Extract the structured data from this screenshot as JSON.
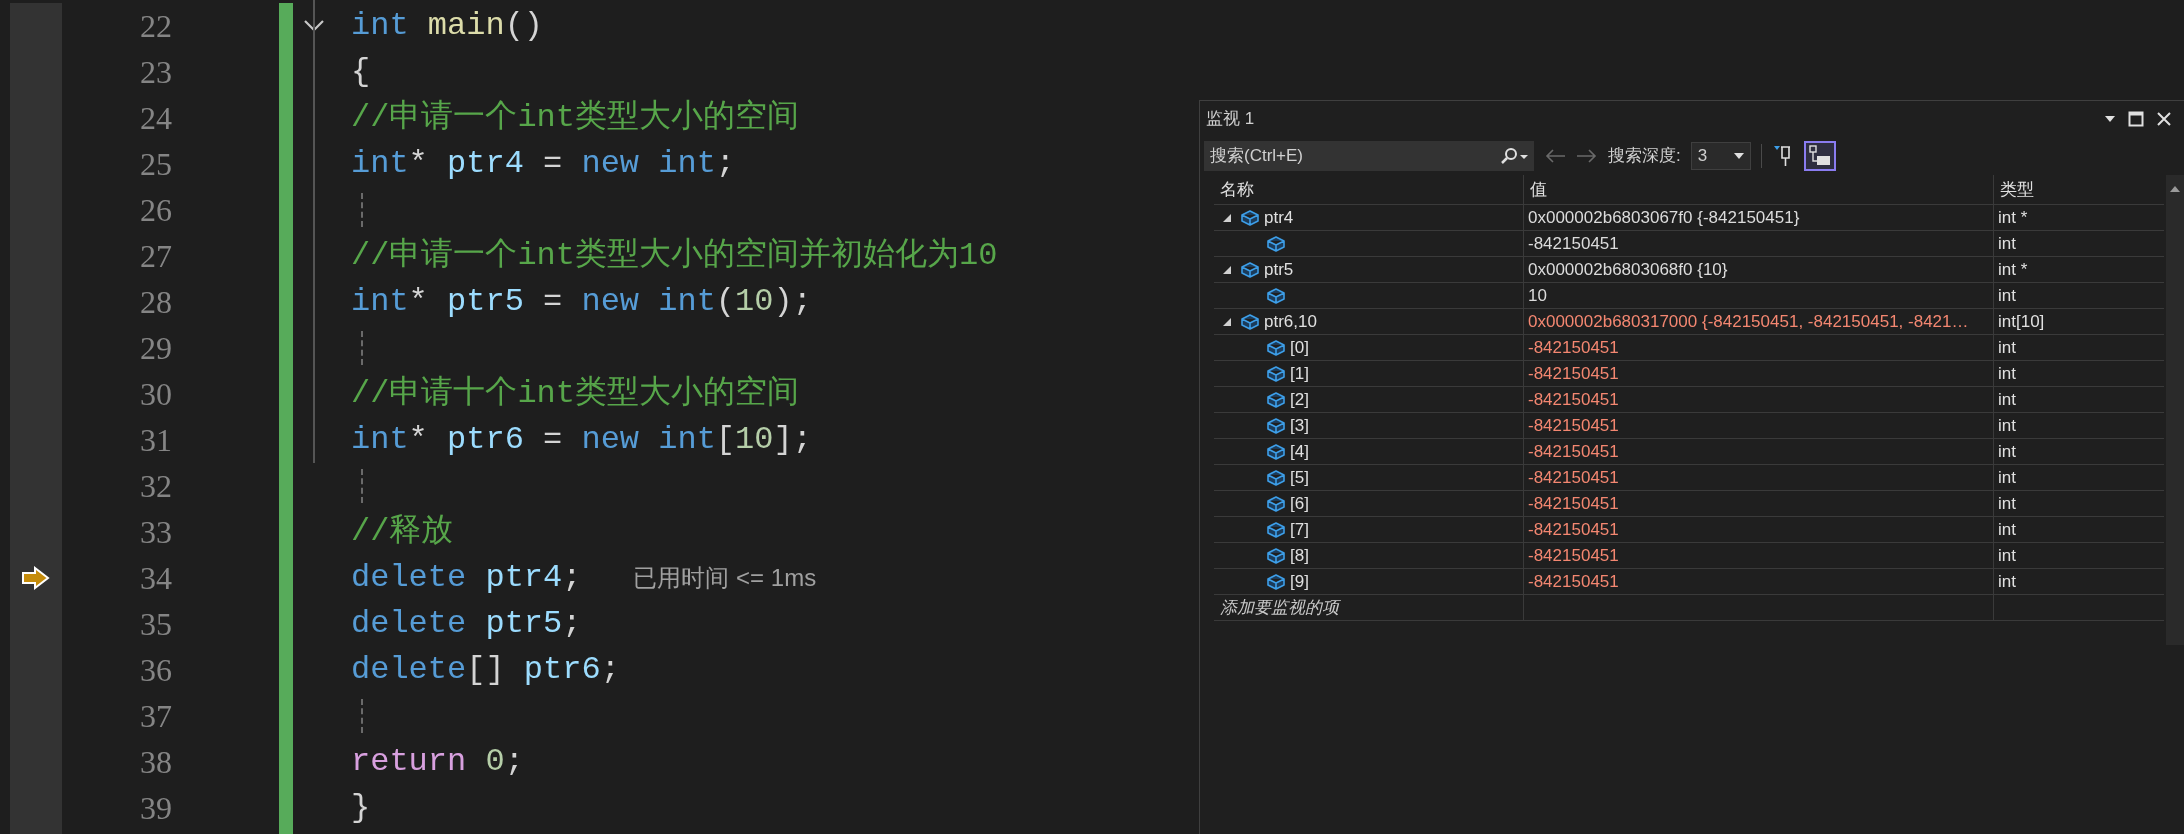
{
  "editor": {
    "lines": [
      {
        "number": "22",
        "folded": false,
        "tokens": [
          {
            "kind": "keyword",
            "text": "int"
          },
          {
            "kind": "function",
            "text": " main"
          },
          {
            "kind": "plain",
            "text": "()"
          }
        ]
      },
      {
        "number": "23",
        "tokens": [
          {
            "kind": "plain",
            "text": "{"
          }
        ]
      },
      {
        "number": "24",
        "tokens": [
          {
            "kind": "comment",
            "text": "//申请一个int类型大小的空间"
          }
        ]
      },
      {
        "number": "25",
        "tokens": [
          {
            "kind": "keyword",
            "text": "int"
          },
          {
            "kind": "plain",
            "text": "* "
          },
          {
            "kind": "variable",
            "text": "ptr4"
          },
          {
            "kind": "plain",
            "text": " = "
          },
          {
            "kind": "keyword",
            "text": "new"
          },
          {
            "kind": "keyword",
            "text": " int"
          },
          {
            "kind": "plain",
            "text": ";"
          }
        ]
      },
      {
        "number": "26"
      },
      {
        "number": "27",
        "tokens": [
          {
            "kind": "comment",
            "text": "//申请一个int类型大小的空间并初始化为10"
          }
        ]
      },
      {
        "number": "28",
        "tokens": [
          {
            "kind": "keyword",
            "text": "int"
          },
          {
            "kind": "plain",
            "text": "* "
          },
          {
            "kind": "variable",
            "text": "ptr5"
          },
          {
            "kind": "plain",
            "text": " = "
          },
          {
            "kind": "keyword",
            "text": "new"
          },
          {
            "kind": "keyword",
            "text": " int"
          },
          {
            "kind": "plain",
            "text": "("
          },
          {
            "kind": "number",
            "text": "10"
          },
          {
            "kind": "plain",
            "text": ");"
          }
        ]
      },
      {
        "number": "29"
      },
      {
        "number": "30",
        "tokens": [
          {
            "kind": "comment",
            "text": "//申请十个int类型大小的空间"
          }
        ]
      },
      {
        "number": "31",
        "tokens": [
          {
            "kind": "keyword",
            "text": "int"
          },
          {
            "kind": "plain",
            "text": "* "
          },
          {
            "kind": "variable",
            "text": "ptr6"
          },
          {
            "kind": "plain",
            "text": " = "
          },
          {
            "kind": "keyword",
            "text": "new"
          },
          {
            "kind": "keyword",
            "text": " int"
          },
          {
            "kind": "plain",
            "text": "["
          },
          {
            "kind": "number",
            "text": "10"
          },
          {
            "kind": "plain",
            "text": "];"
          }
        ]
      },
      {
        "number": "32"
      },
      {
        "number": "33",
        "tokens": [
          {
            "kind": "comment",
            "text": "//释放"
          }
        ]
      },
      {
        "number": "34",
        "current": true,
        "hint": "已用时间 <= 1ms",
        "tokens": [
          {
            "kind": "keyword",
            "text": "delete"
          },
          {
            "kind": "variable",
            "text": " ptr4"
          },
          {
            "kind": "plain",
            "text": ";"
          }
        ]
      },
      {
        "number": "35",
        "tokens": [
          {
            "kind": "keyword",
            "text": "delete"
          },
          {
            "kind": "variable",
            "text": " ptr5"
          },
          {
            "kind": "plain",
            "text": ";"
          }
        ]
      },
      {
        "number": "36",
        "tokens": [
          {
            "kind": "keyword",
            "text": "delete"
          },
          {
            "kind": "plain",
            "text": "[] "
          },
          {
            "kind": "variable",
            "text": "ptr6"
          },
          {
            "kind": "plain",
            "text": ";"
          }
        ]
      },
      {
        "number": "37"
      },
      {
        "number": "38",
        "tokens": [
          {
            "kind": "control",
            "text": "return"
          },
          {
            "kind": "number",
            "text": " 0"
          },
          {
            "kind": "plain",
            "text": ";"
          }
        ]
      },
      {
        "number": "39",
        "tokens": [
          {
            "kind": "plain",
            "text": "}"
          }
        ]
      }
    ]
  },
  "watch": {
    "title": "监视 1",
    "search": {
      "placeholder": "搜索(Ctrl+E)"
    },
    "depth_label": "搜索深度:",
    "depth": "3",
    "format_toggle": {
      "selected": true
    },
    "columns": [
      "名称",
      "值",
      "类型"
    ],
    "rows": [
      {
        "name": "ptr4",
        "value": "0x000002b6803067f0 {-842150451}",
        "type": "int *",
        "changed": false,
        "expanded": true,
        "children": [
          {
            "value": "-842150451",
            "type": "int",
            "changed": false
          }
        ]
      },
      {
        "name": "ptr5",
        "value": "0x000002b6803068f0 {10}",
        "type": "int *",
        "changed": false,
        "expanded": true,
        "children": [
          {
            "value": "10",
            "type": "int",
            "changed": false
          }
        ]
      },
      {
        "name": "ptr6,10",
        "value": "0x000002b680317000 {-842150451, -842150451, -8421…",
        "type": "int[10]",
        "changed": true,
        "expanded": true,
        "children": [
          {
            "name": "[0]",
            "value": "-842150451",
            "type": "int",
            "changed": true
          },
          {
            "name": "[1]",
            "value": "-842150451",
            "type": "int",
            "changed": true
          },
          {
            "name": "[2]",
            "value": "-842150451",
            "type": "int",
            "changed": true
          },
          {
            "name": "[3]",
            "value": "-842150451",
            "type": "int",
            "changed": true
          },
          {
            "name": "[4]",
            "value": "-842150451",
            "type": "int",
            "changed": true
          },
          {
            "name": "[5]",
            "value": "-842150451",
            "type": "int",
            "changed": true
          },
          {
            "name": "[6]",
            "value": "-842150451",
            "type": "int",
            "changed": true
          },
          {
            "name": "[7]",
            "value": "-842150451",
            "type": "int",
            "changed": true
          },
          {
            "name": "[8]",
            "value": "-842150451",
            "type": "int",
            "changed": true
          },
          {
            "name": "[9]",
            "value": "-842150451",
            "type": "int",
            "changed": true
          }
        ]
      }
    ],
    "add_row": "添加要监视的项"
  }
}
